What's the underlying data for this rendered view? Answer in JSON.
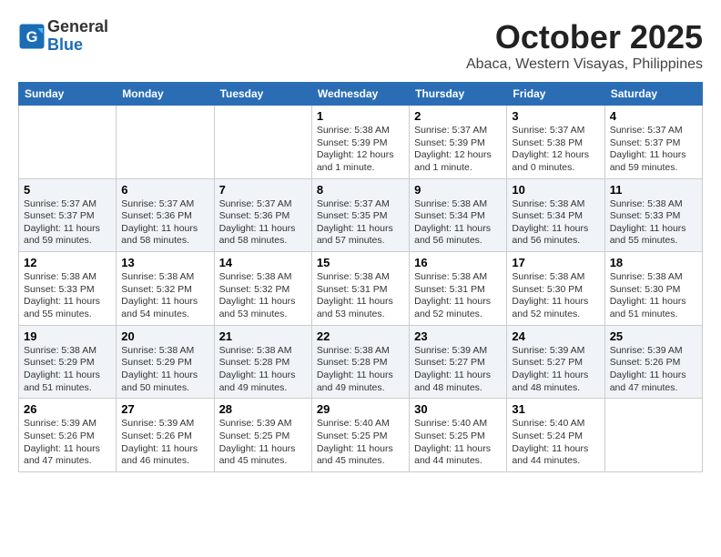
{
  "header": {
    "logo_line1": "General",
    "logo_line2": "Blue",
    "month": "October 2025",
    "location": "Abaca, Western Visayas, Philippines"
  },
  "weekdays": [
    "Sunday",
    "Monday",
    "Tuesday",
    "Wednesday",
    "Thursday",
    "Friday",
    "Saturday"
  ],
  "weeks": [
    [
      {
        "day": "",
        "info": ""
      },
      {
        "day": "",
        "info": ""
      },
      {
        "day": "",
        "info": ""
      },
      {
        "day": "1",
        "info": "Sunrise: 5:38 AM\nSunset: 5:39 PM\nDaylight: 12 hours\nand 1 minute."
      },
      {
        "day": "2",
        "info": "Sunrise: 5:37 AM\nSunset: 5:39 PM\nDaylight: 12 hours\nand 1 minute."
      },
      {
        "day": "3",
        "info": "Sunrise: 5:37 AM\nSunset: 5:38 PM\nDaylight: 12 hours\nand 0 minutes."
      },
      {
        "day": "4",
        "info": "Sunrise: 5:37 AM\nSunset: 5:37 PM\nDaylight: 11 hours\nand 59 minutes."
      }
    ],
    [
      {
        "day": "5",
        "info": "Sunrise: 5:37 AM\nSunset: 5:37 PM\nDaylight: 11 hours\nand 59 minutes."
      },
      {
        "day": "6",
        "info": "Sunrise: 5:37 AM\nSunset: 5:36 PM\nDaylight: 11 hours\nand 58 minutes."
      },
      {
        "day": "7",
        "info": "Sunrise: 5:37 AM\nSunset: 5:36 PM\nDaylight: 11 hours\nand 58 minutes."
      },
      {
        "day": "8",
        "info": "Sunrise: 5:37 AM\nSunset: 5:35 PM\nDaylight: 11 hours\nand 57 minutes."
      },
      {
        "day": "9",
        "info": "Sunrise: 5:38 AM\nSunset: 5:34 PM\nDaylight: 11 hours\nand 56 minutes."
      },
      {
        "day": "10",
        "info": "Sunrise: 5:38 AM\nSunset: 5:34 PM\nDaylight: 11 hours\nand 56 minutes."
      },
      {
        "day": "11",
        "info": "Sunrise: 5:38 AM\nSunset: 5:33 PM\nDaylight: 11 hours\nand 55 minutes."
      }
    ],
    [
      {
        "day": "12",
        "info": "Sunrise: 5:38 AM\nSunset: 5:33 PM\nDaylight: 11 hours\nand 55 minutes."
      },
      {
        "day": "13",
        "info": "Sunrise: 5:38 AM\nSunset: 5:32 PM\nDaylight: 11 hours\nand 54 minutes."
      },
      {
        "day": "14",
        "info": "Sunrise: 5:38 AM\nSunset: 5:32 PM\nDaylight: 11 hours\nand 53 minutes."
      },
      {
        "day": "15",
        "info": "Sunrise: 5:38 AM\nSunset: 5:31 PM\nDaylight: 11 hours\nand 53 minutes."
      },
      {
        "day": "16",
        "info": "Sunrise: 5:38 AM\nSunset: 5:31 PM\nDaylight: 11 hours\nand 52 minutes."
      },
      {
        "day": "17",
        "info": "Sunrise: 5:38 AM\nSunset: 5:30 PM\nDaylight: 11 hours\nand 52 minutes."
      },
      {
        "day": "18",
        "info": "Sunrise: 5:38 AM\nSunset: 5:30 PM\nDaylight: 11 hours\nand 51 minutes."
      }
    ],
    [
      {
        "day": "19",
        "info": "Sunrise: 5:38 AM\nSunset: 5:29 PM\nDaylight: 11 hours\nand 51 minutes."
      },
      {
        "day": "20",
        "info": "Sunrise: 5:38 AM\nSunset: 5:29 PM\nDaylight: 11 hours\nand 50 minutes."
      },
      {
        "day": "21",
        "info": "Sunrise: 5:38 AM\nSunset: 5:28 PM\nDaylight: 11 hours\nand 49 minutes."
      },
      {
        "day": "22",
        "info": "Sunrise: 5:38 AM\nSunset: 5:28 PM\nDaylight: 11 hours\nand 49 minutes."
      },
      {
        "day": "23",
        "info": "Sunrise: 5:39 AM\nSunset: 5:27 PM\nDaylight: 11 hours\nand 48 minutes."
      },
      {
        "day": "24",
        "info": "Sunrise: 5:39 AM\nSunset: 5:27 PM\nDaylight: 11 hours\nand 48 minutes."
      },
      {
        "day": "25",
        "info": "Sunrise: 5:39 AM\nSunset: 5:26 PM\nDaylight: 11 hours\nand 47 minutes."
      }
    ],
    [
      {
        "day": "26",
        "info": "Sunrise: 5:39 AM\nSunset: 5:26 PM\nDaylight: 11 hours\nand 47 minutes."
      },
      {
        "day": "27",
        "info": "Sunrise: 5:39 AM\nSunset: 5:26 PM\nDaylight: 11 hours\nand 46 minutes."
      },
      {
        "day": "28",
        "info": "Sunrise: 5:39 AM\nSunset: 5:25 PM\nDaylight: 11 hours\nand 45 minutes."
      },
      {
        "day": "29",
        "info": "Sunrise: 5:40 AM\nSunset: 5:25 PM\nDaylight: 11 hours\nand 45 minutes."
      },
      {
        "day": "30",
        "info": "Sunrise: 5:40 AM\nSunset: 5:25 PM\nDaylight: 11 hours\nand 44 minutes."
      },
      {
        "day": "31",
        "info": "Sunrise: 5:40 AM\nSunset: 5:24 PM\nDaylight: 11 hours\nand 44 minutes."
      },
      {
        "day": "",
        "info": ""
      }
    ]
  ]
}
